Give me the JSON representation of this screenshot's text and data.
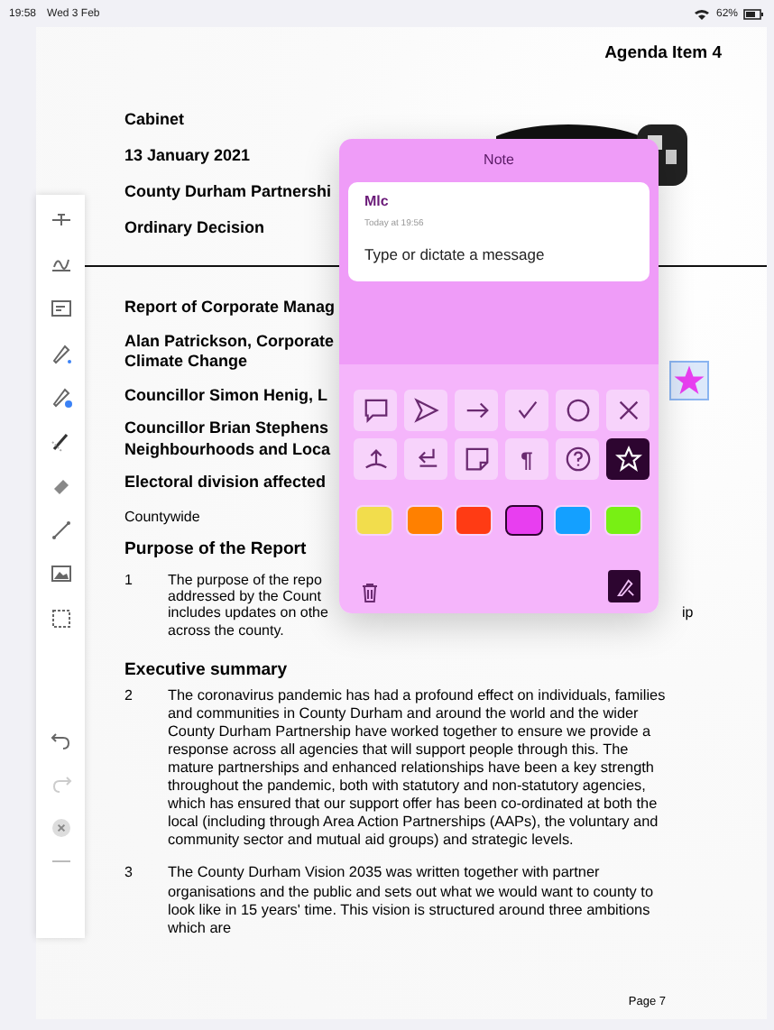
{
  "status_bar": {
    "time": "19:58",
    "date": "Wed 3 Feb",
    "battery": "62%"
  },
  "document": {
    "agenda": "Agenda Item 4",
    "header_lines": [
      "Cabinet",
      "13 January 2021",
      "County Durham Partnershi",
      "Ordinary Decision"
    ],
    "report_lines": [
      {
        "kind": "heading",
        "text": "Report of Corporate Manag"
      },
      {
        "kind": "heading",
        "text": "Alan Patrickson, Corporate\nClimate Change"
      },
      {
        "kind": "heading",
        "text": "Councillor Simon Henig, L"
      },
      {
        "kind": "heading",
        "text": "Councillor Brian Stephens\nNeighbourhoods and Loca"
      },
      {
        "kind": "heading",
        "text": "Electoral division affected"
      },
      {
        "kind": "plain",
        "text": "Countywide"
      },
      {
        "kind": "section",
        "text": "Purpose of the Report"
      }
    ],
    "paragraph_1": {
      "number": "1",
      "lines": [
        "The purpose of the repo",
        "addressed by the Count",
        "includes updates on othe",
        "across the county."
      ],
      "fragment": "ip"
    },
    "executive_heading": "Executive summary",
    "paragraphs": [
      {
        "number": "2",
        "text": "The coronavirus pandemic has had a profound effect on individuals, families and communities in County Durham and around the world and the wider County Durham Partnership have worked together to ensure we provide a response across all agencies that will support people through this.  The mature partnerships and enhanced relationships have been a key strength throughout the pandemic, both with statutory and non-statutory agencies, which has ensured that our support offer has been co-ordinated at both the local (including through Area Action Partnerships (AAPs), the voluntary and community sector and mutual aid groups) and strategic levels."
      },
      {
        "number": "3",
        "text": "The County Durham Vision 2035 was written together with partner organisations and the public and sets out what we would want to county to look like in 15 years' time.  This vision is structured around three ambitions which are"
      }
    ],
    "page_number": "Page 7"
  },
  "note": {
    "title": "Note",
    "author": "Mlc",
    "time": "Today at 19:56",
    "placeholder": "Type or dictate a message",
    "shapes": [
      {
        "kind": "comment",
        "selected": false
      },
      {
        "kind": "send",
        "selected": false
      },
      {
        "kind": "arrow",
        "selected": false
      },
      {
        "kind": "check",
        "selected": false
      },
      {
        "kind": "circle",
        "selected": false
      },
      {
        "kind": "cross",
        "selected": false
      },
      {
        "kind": "insert",
        "selected": false
      },
      {
        "kind": "space",
        "selected": false
      },
      {
        "kind": "note",
        "selected": false
      },
      {
        "kind": "paragraph",
        "label": "¶",
        "selected": false
      },
      {
        "kind": "help",
        "selected": false
      },
      {
        "kind": "star",
        "selected": true
      }
    ],
    "colors": [
      {
        "color": "#f2dd4c",
        "selected": false
      },
      {
        "color": "#ff8000",
        "selected": false
      },
      {
        "color": "#ff3b14",
        "selected": false
      },
      {
        "color": "#e83ef0",
        "selected": true
      },
      {
        "color": "#14a0ff",
        "selected": false
      },
      {
        "color": "#78f014",
        "selected": false
      }
    ]
  }
}
